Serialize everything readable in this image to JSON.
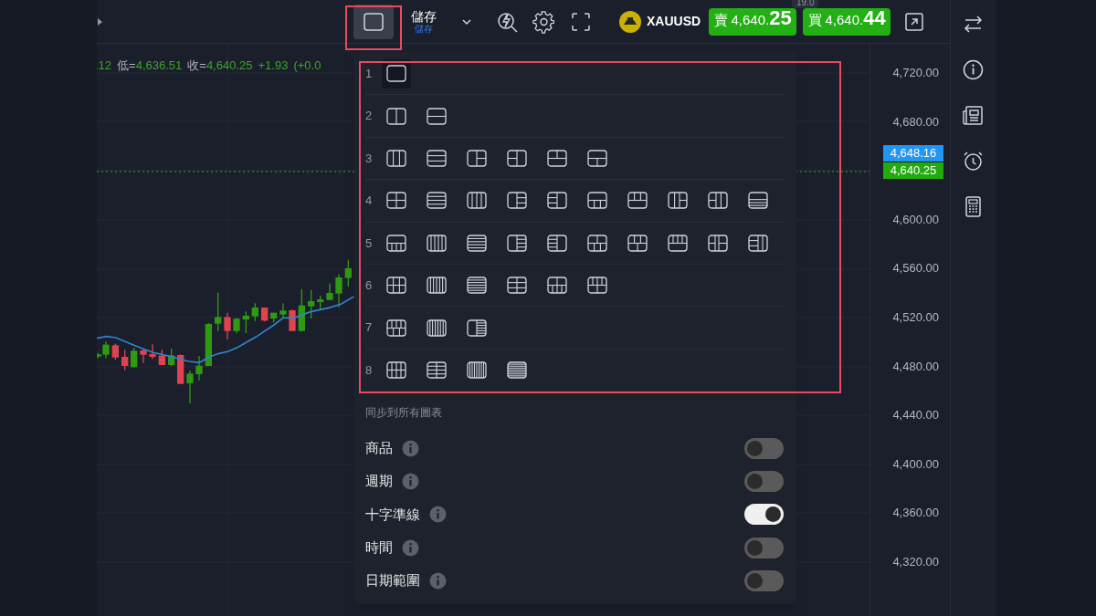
{
  "toolbar": {
    "layout_button": {
      "active": true
    },
    "save": {
      "label": "儲存",
      "sublabel": "儲存"
    },
    "symbol": "XAUUSD",
    "sell": {
      "label": "賣",
      "price": "4,640.",
      "price_big": "25"
    },
    "spread": "19.0",
    "buy": {
      "label": "買",
      "price": "4,640.",
      "price_big": "44"
    }
  },
  "ohlc": [
    {
      "value": ".12"
    },
    {
      "label": "低=",
      "value": "4,636.51"
    },
    {
      "label": "收=",
      "value": "4,640.25"
    },
    {
      "value": "+1.93"
    },
    {
      "value": "(+0.0"
    }
  ],
  "price_axis": {
    "labels": [
      "4,720.00",
      "4,680.00",
      "4,600.00",
      "4,560.00",
      "4,520.00",
      "4,480.00",
      "4,440.00",
      "4,400.00",
      "4,360.00",
      "4,320.00"
    ],
    "badges": [
      {
        "text": "4,648.16",
        "color": "#2196f3"
      },
      {
        "text": "4,640.25",
        "color": "#22ab0f"
      }
    ]
  },
  "layout_menu": {
    "rows": [
      {
        "count": "1",
        "options": [
          {
            "selected": true
          }
        ]
      },
      {
        "count": "2",
        "options": [
          {
            "selected": false
          },
          {
            "selected": false
          }
        ]
      },
      {
        "count": "3",
        "options": [
          {
            "selected": false
          },
          {
            "selected": false
          },
          {
            "selected": false
          },
          {
            "selected": false
          },
          {
            "selected": false
          },
          {
            "selected": false
          }
        ]
      },
      {
        "count": "4",
        "options": [
          {
            "selected": false
          },
          {
            "selected": false
          },
          {
            "selected": false
          },
          {
            "selected": false
          },
          {
            "selected": false
          },
          {
            "selected": false
          },
          {
            "selected": false
          },
          {
            "selected": false
          },
          {
            "selected": false
          },
          {
            "selected": false
          }
        ]
      },
      {
        "count": "5",
        "options": [
          {
            "selected": false
          },
          {
            "selected": false
          },
          {
            "selected": false
          },
          {
            "selected": false
          },
          {
            "selected": false
          },
          {
            "selected": false
          },
          {
            "selected": false
          },
          {
            "selected": false
          },
          {
            "selected": false
          },
          {
            "selected": false
          }
        ]
      },
      {
        "count": "6",
        "options": [
          {
            "selected": false
          },
          {
            "selected": false
          },
          {
            "selected": false
          },
          {
            "selected": false
          },
          {
            "selected": false
          },
          {
            "selected": false
          }
        ]
      },
      {
        "count": "7",
        "options": [
          {
            "selected": false
          },
          {
            "selected": false
          },
          {
            "selected": false
          }
        ]
      },
      {
        "count": "8",
        "options": [
          {
            "selected": false
          },
          {
            "selected": false
          },
          {
            "selected": false
          },
          {
            "selected": false
          }
        ]
      }
    ],
    "sync_title": "同步到所有圖表",
    "sync_options": [
      {
        "label": "商品",
        "on": false
      },
      {
        "label": "週期",
        "on": false
      },
      {
        "label": "十字準線",
        "on": true
      },
      {
        "label": "時間",
        "on": false
      },
      {
        "label": "日期範圍",
        "on": false
      }
    ]
  }
}
